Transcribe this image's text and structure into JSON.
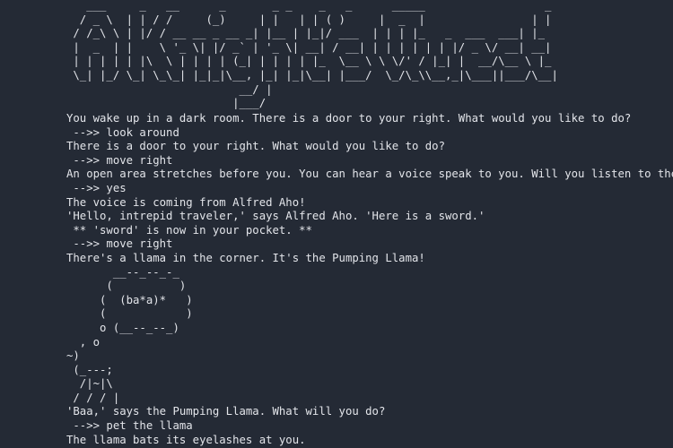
{
  "terminal": {
    "banner": [
      "   ___     _   __      _       _ _    _   _      _____                  _",
      "  / _ \\  | | / /     (_)     | |   | | ( )     |  _  |                | |",
      " / /_\\ \\ | |/ / __ __ _ __ _| |__ | |_|/ ___  | | | |_   _  ___  ___| |_",
      " |  _  | |    \\ '_ \\| |/ _` | '_ \\| __| / __| | | | | | | |/ _ \\/ __| __|",
      " | | | | | |\\  \\ | | | | (_| | | | | |_  \\__ \\ \\ \\/' / |_| |  __/\\__ \\ |_",
      " \\_| |_/ \\_| \\_\\_| |_|_|\\__, |_| |_|\\__| |___/  \\_/\\_\\\\__,_|\\___||___/\\__|",
      "                          __/ |",
      "                         |___/"
    ],
    "lines": [
      "You wake up in a dark room. There is a door to your right. What would you like to do?",
      " -->> look around",
      "There is a door to your right. What would you like to do?",
      " -->> move right",
      "An open area stretches before you. You can hear a voice speak to you. Will you listen to the voice?",
      " -->> yes",
      "The voice is coming from Alfred Aho!",
      "'Hello, intrepid traveler,' says Alfred Aho. 'Here is a sword.'",
      " ** 'sword' is now in your pocket. **",
      " -->> move right",
      "There's a llama in the corner. It's the Pumping Llama!",
      "       __--_--_-_",
      "      (          )",
      "     (  (ba*a)*   )",
      "     (            )",
      "     o (__--_--_)",
      "  , o",
      "~)",
      " (_---;",
      "  /|~|\\",
      " / / / |",
      "'Baa,' says the Pumping Llama. What will you do?",
      " -->> pet the llama",
      "The llama bats its eyelashes at you."
    ]
  }
}
